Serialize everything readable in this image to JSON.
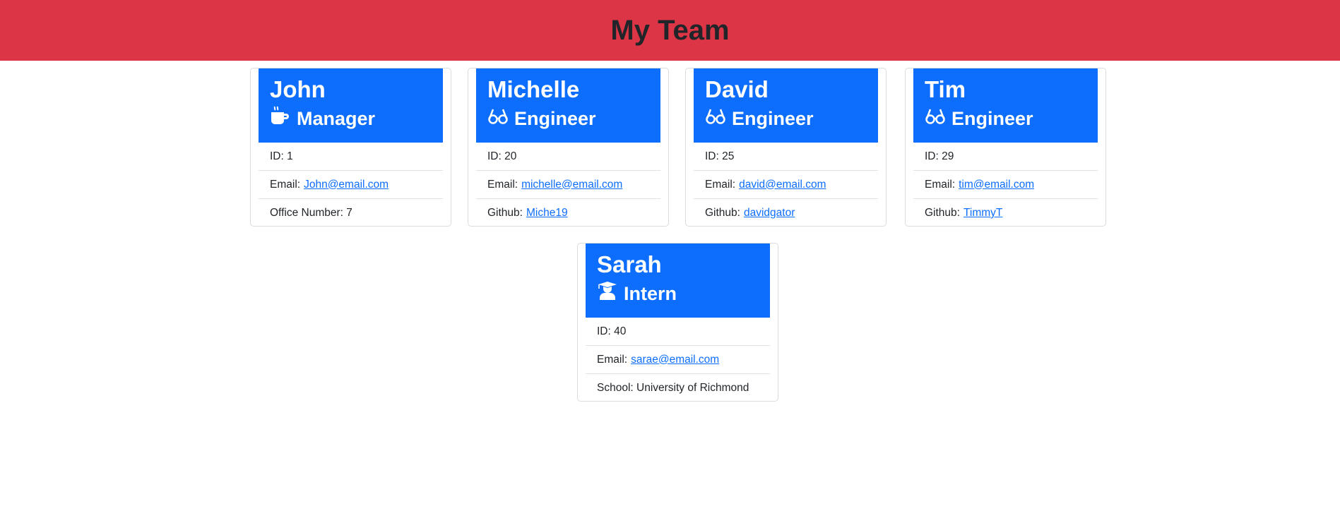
{
  "header": {
    "title": "My Team"
  },
  "employees": [
    {
      "name": "John",
      "role": "Manager",
      "icon": "mug-icon",
      "id_label": "ID: 1",
      "email_label": "Email:",
      "email": "John@email.com",
      "extra_label": "Office Number: 7"
    },
    {
      "name": "Michelle",
      "role": "Engineer",
      "icon": "glasses-icon",
      "id_label": "ID: 20",
      "email_label": "Email:",
      "email": "michelle@email.com",
      "extra_label": "Github:",
      "extra_link": "Miche19"
    },
    {
      "name": "David",
      "role": "Engineer",
      "icon": "glasses-icon",
      "id_label": "ID: 25",
      "email_label": "Email:",
      "email": "david@email.com",
      "extra_label": "Github:",
      "extra_link": "davidgator"
    },
    {
      "name": "Tim",
      "role": "Engineer",
      "icon": "glasses-icon",
      "id_label": "ID: 29",
      "email_label": "Email:",
      "email": "tim@email.com",
      "extra_label": "Github:",
      "extra_link": "TimmyT"
    },
    {
      "name": "Sarah",
      "role": "Intern",
      "icon": "graduate-icon",
      "id_label": "ID: 40",
      "email_label": "Email:",
      "email": "sarae@email.com",
      "extra_label": "School: University of Richmond"
    }
  ],
  "colors": {
    "header": "#dc3545",
    "card_header": "#0d6efd",
    "link": "#0d6efd"
  }
}
